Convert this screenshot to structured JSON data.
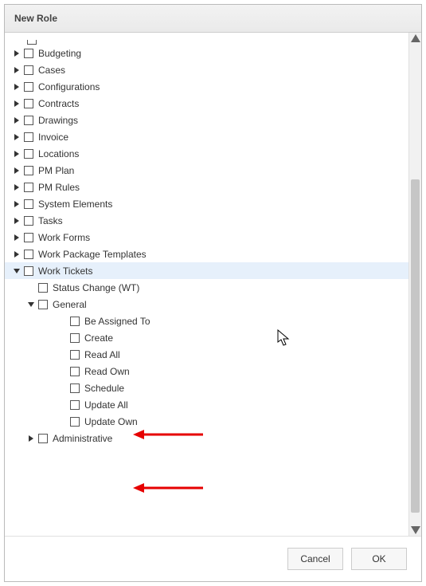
{
  "dialog": {
    "title": "New Role"
  },
  "tree": {
    "top_placeholder_checked": false,
    "items": [
      {
        "label": "Budgeting",
        "expanded": false
      },
      {
        "label": "Cases",
        "expanded": false
      },
      {
        "label": "Configurations",
        "expanded": false
      },
      {
        "label": "Contracts",
        "expanded": false
      },
      {
        "label": "Drawings",
        "expanded": false
      },
      {
        "label": "Invoice",
        "expanded": false
      },
      {
        "label": "Locations",
        "expanded": false
      },
      {
        "label": "PM Plan",
        "expanded": false
      },
      {
        "label": "PM Rules",
        "expanded": false
      },
      {
        "label": "System Elements",
        "expanded": false
      },
      {
        "label": "Tasks",
        "expanded": false
      },
      {
        "label": "Work Forms",
        "expanded": false
      },
      {
        "label": "Work Package Templates",
        "expanded": false
      },
      {
        "label": "Work Tickets",
        "expanded": true,
        "selected": true
      }
    ],
    "work_tickets_children": [
      {
        "label": "Status Change (WT)",
        "type": "leaf"
      },
      {
        "label": "General",
        "type": "node",
        "expanded": true
      },
      {
        "label": "Administrative",
        "type": "node",
        "expanded": false
      }
    ],
    "general_children": [
      {
        "label": "Be Assigned To"
      },
      {
        "label": "Create"
      },
      {
        "label": "Read All"
      },
      {
        "label": "Read Own"
      },
      {
        "label": "Schedule"
      },
      {
        "label": "Update All"
      },
      {
        "label": "Update Own"
      }
    ]
  },
  "footer": {
    "cancel_label": "Cancel",
    "ok_label": "OK"
  },
  "annotations": {
    "arrow1_target": "Read All / Read Own gap",
    "arrow2_target": "Update All / Update Own gap"
  }
}
